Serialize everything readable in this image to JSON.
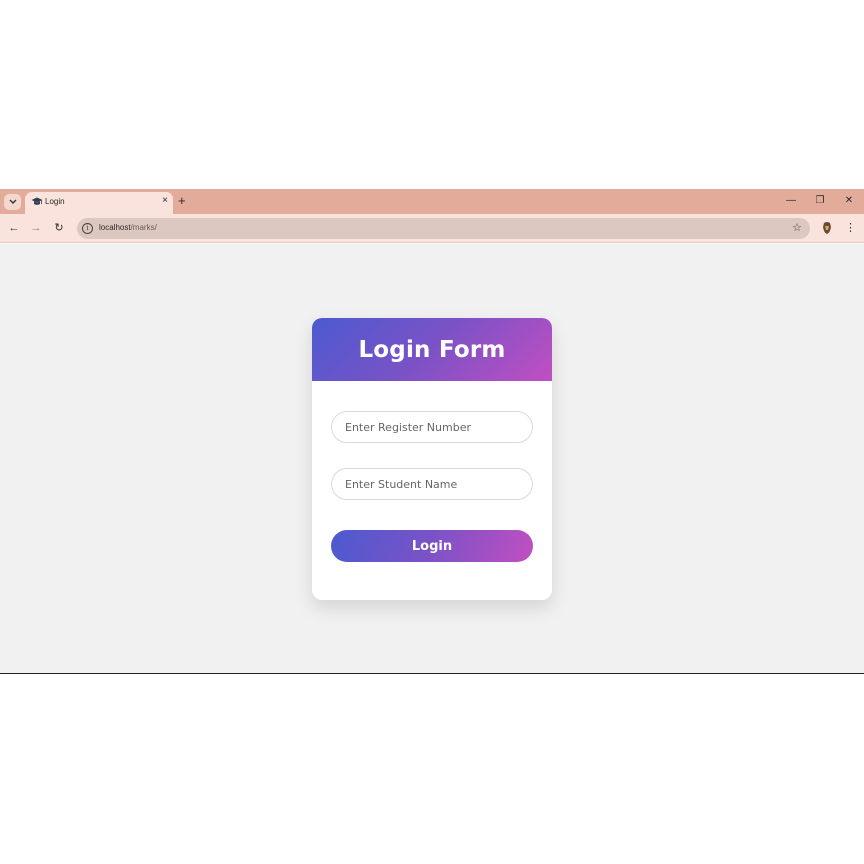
{
  "browser": {
    "tab": {
      "title": "Login",
      "close": "×"
    },
    "new_tab": "+",
    "controls": {
      "minimize": "—",
      "restore": "❐",
      "close": "✕"
    },
    "nav": {
      "back": "←",
      "forward": "→",
      "reload": "↻"
    },
    "address": {
      "host": "localhost",
      "path": "/marks/"
    },
    "star": "☆",
    "menu": "⋮"
  },
  "form": {
    "title": "Login Form",
    "register_placeholder": "Enter Register Number",
    "name_placeholder": "Enter Student Name",
    "submit_label": "Login"
  },
  "colors": {
    "tabstrip": "#e3ac9a",
    "toolbar": "#f9e3dc",
    "gradient_start": "#4c5ad0",
    "gradient_end": "#c14fc2",
    "page_bg": "#f1f1f1"
  }
}
